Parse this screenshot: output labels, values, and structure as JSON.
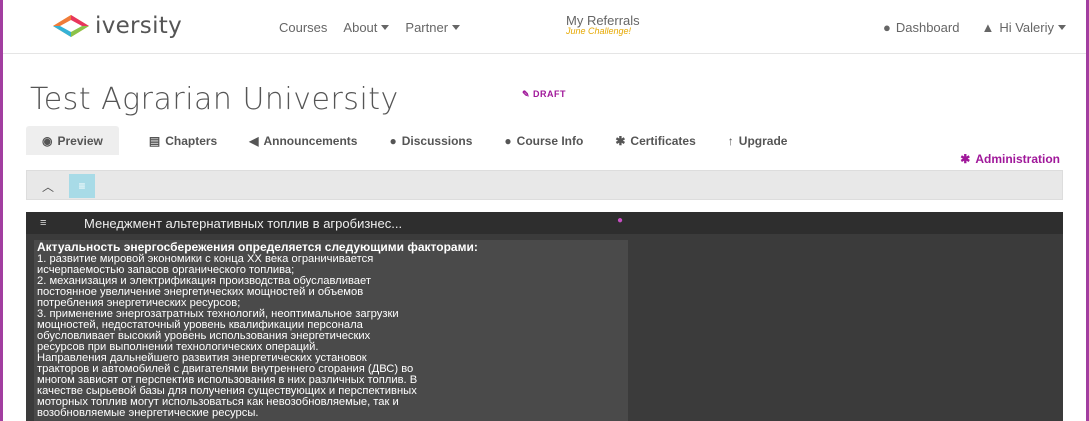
{
  "brand": {
    "name": "iversity"
  },
  "nav": {
    "courses": "Courses",
    "about": "About",
    "partner": "Partner",
    "referrals": "My Referrals",
    "referrals_sub": "June Challenge!",
    "dashboard": "Dashboard",
    "user": "Hi Valeriy"
  },
  "course": {
    "title": "Test Agrarian University",
    "draft": "DRAFT"
  },
  "tabs": [
    {
      "icon": "eye-icon",
      "label": "Preview"
    },
    {
      "icon": "film-icon",
      "label": "Chapters"
    },
    {
      "icon": "bullhorn-icon",
      "label": "Announcements"
    },
    {
      "icon": "comment-icon",
      "label": "Discussions"
    },
    {
      "icon": "info-icon",
      "label": "Course Info"
    },
    {
      "icon": "certificate-icon",
      "label": "Certificates"
    },
    {
      "icon": "arrow-up-icon",
      "label": "Upgrade"
    }
  ],
  "admin": {
    "label": "Administration"
  },
  "panel": {
    "title": "Менеджмент альтернативных топлив в агробизнес...",
    "lead": "Актуальность энергосбережения определяется следующими факторами:",
    "lines": [
      "1. развитие мировой экономики с конца XX века ограничивается",
      "исчерпаемостью запасов органического топлива;",
      "2. механизация и электрификация производства обуславливает",
      "постоянное увеличение энергетических мощностей и объемов",
      "потребления энергетических ресурсов;",
      "3. применение энергозатратных технологий, неоптимальное загрузки",
      "мощностей, недостаточный уровень квалификации персонала",
      "обусловливает высокий уровень использования энергетических",
      "ресурсов при выполнении технологических операций.",
      "Направления дальнейшего развития энергетических установок",
      "тракторов и автомобилей с двигателями внутреннего сгорания (ДВС) во",
      "многом зависят от перспектив использования в них различных топлив. В",
      "качестве сырьевой базы для получения существующих и перспективных",
      "моторных топлив могут использоваться как невозобновляемые, так и",
      "возобновляемые энергетические ресурсы."
    ]
  },
  "colors": {
    "accent": "#a0189a",
    "frame": "#a23ea0",
    "panel": "#3b3b3b",
    "highlight": "#a8dbe7"
  }
}
